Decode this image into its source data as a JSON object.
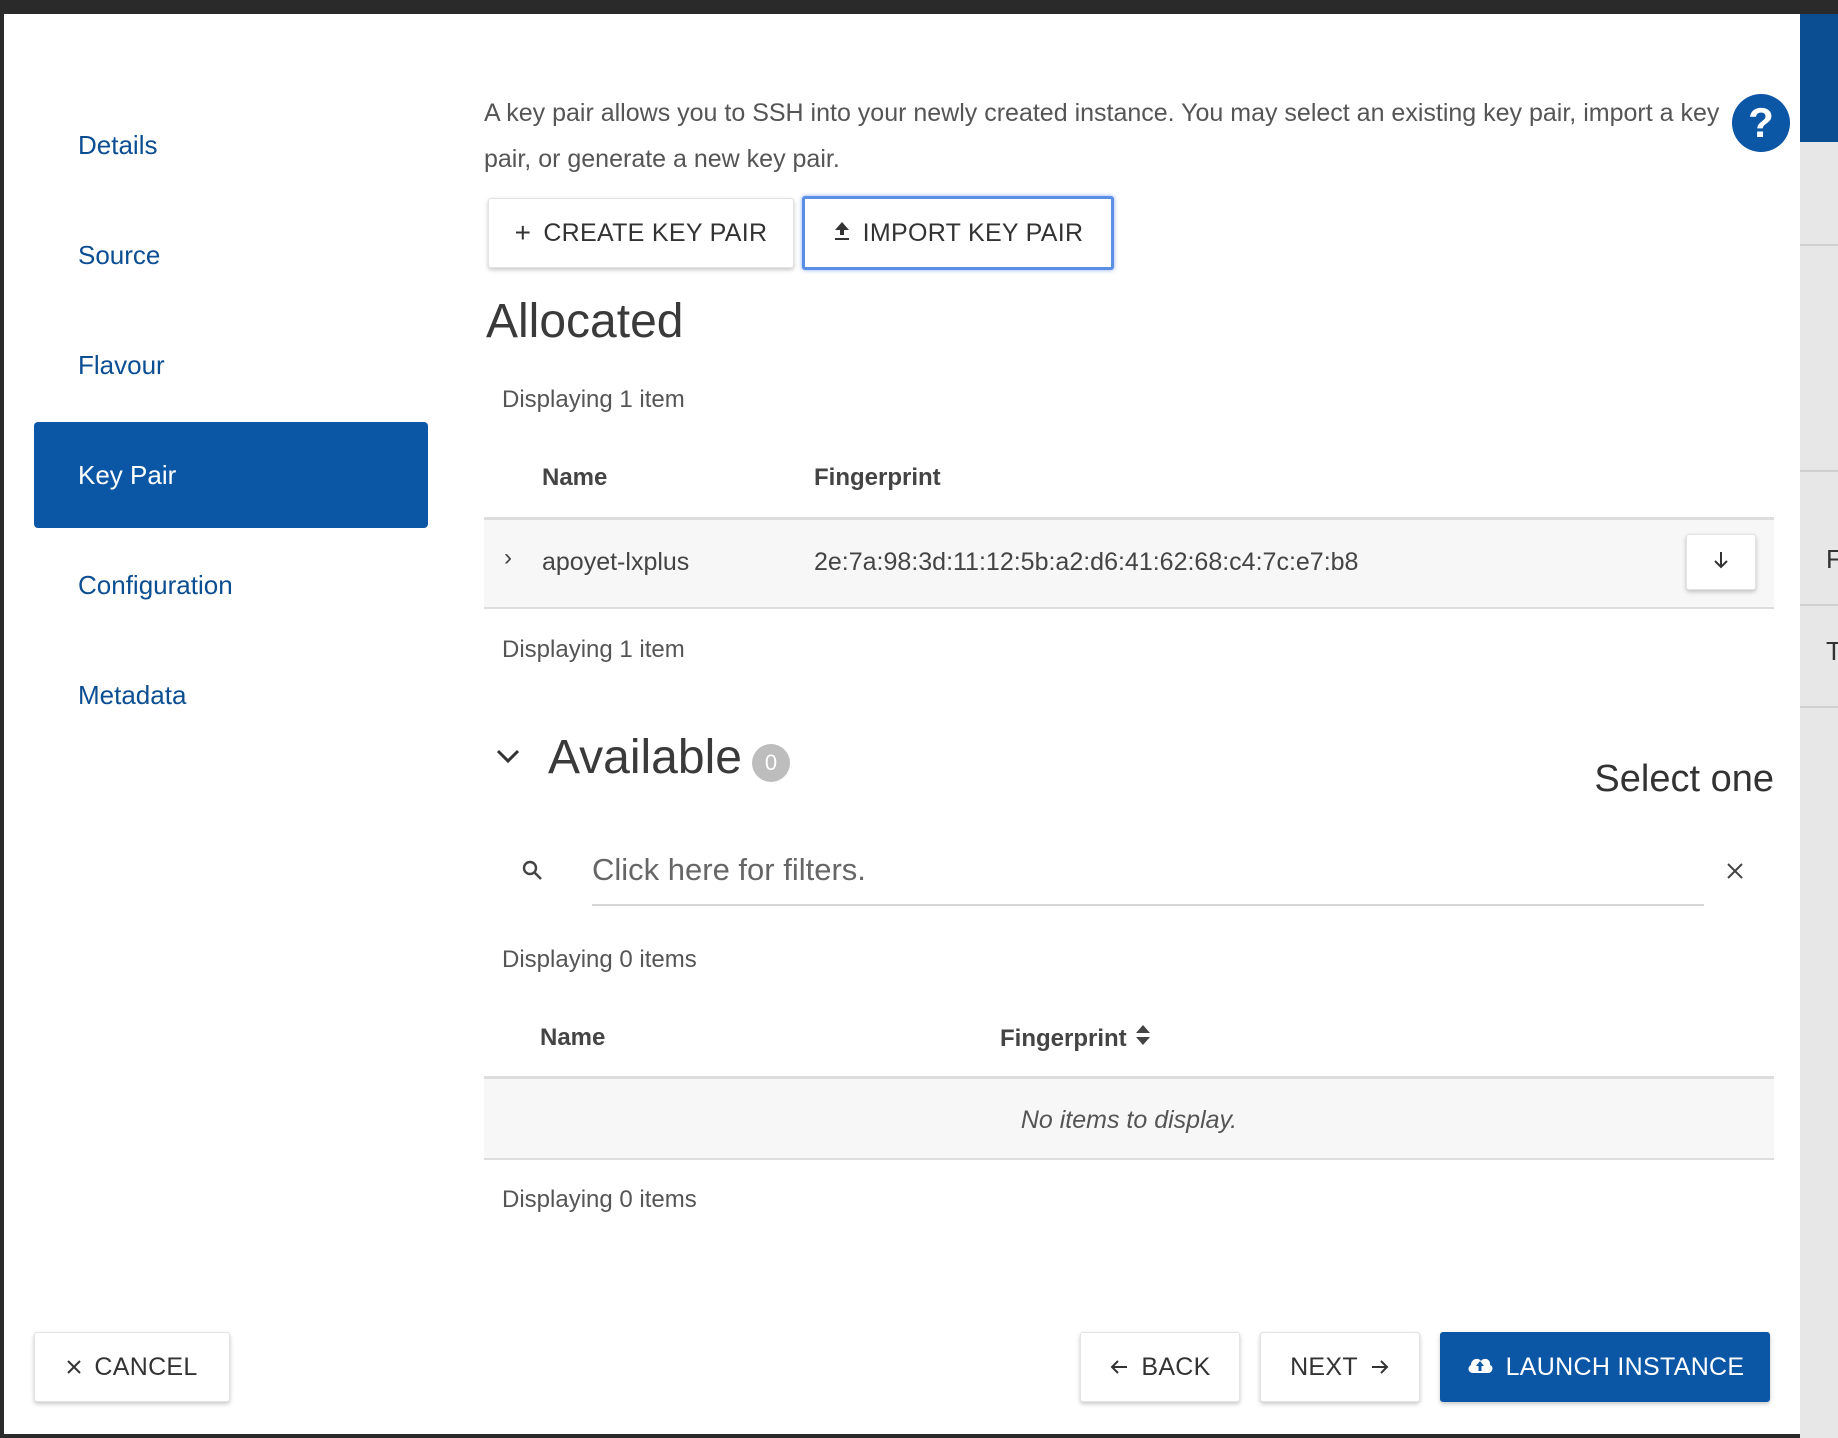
{
  "sidebar": {
    "items": [
      {
        "label": "Details"
      },
      {
        "label": "Source"
      },
      {
        "label": "Flavour"
      },
      {
        "label": "Key Pair"
      },
      {
        "label": "Configuration"
      },
      {
        "label": "Metadata"
      }
    ],
    "active": "Key Pair"
  },
  "main": {
    "help_text": "A key pair allows you to SSH into your newly created instance. You may select an existing key pair, import a key pair, or generate a new key pair.",
    "help_icon": "?",
    "create_label": "CREATE KEY PAIR",
    "import_label": "IMPORT KEY PAIR"
  },
  "allocated": {
    "title": "Allocated",
    "count_top": "Displaying 1 item",
    "count_bottom": "Displaying 1 item",
    "columns": {
      "name": "Name",
      "fingerprint": "Fingerprint"
    },
    "rows": [
      {
        "name": "apoyet-lxplus",
        "fingerprint": "2e:7a:98:3d:11:12:5b:a2:d6:41:62:68:c4:7c:e7:b8"
      }
    ]
  },
  "available": {
    "title": "Available",
    "badge": "0",
    "select_hint": "Select one",
    "filter_placeholder": "Click here for filters.",
    "count_top": "Displaying 0 items",
    "count_bottom": "Displaying 0 items",
    "columns": {
      "name": "Name",
      "fingerprint": "Fingerprint"
    },
    "empty_text": "No items to display."
  },
  "footer": {
    "cancel_label": "CANCEL",
    "back_label": "BACK",
    "next_label": "NEXT",
    "launch_label": "LAUNCH INSTANCE"
  },
  "colors": {
    "accent": "#0c56a6",
    "nav_text": "#0c4e92",
    "focus_ring": "#5b8fe6"
  },
  "background_peek": [
    "F",
    "T"
  ]
}
